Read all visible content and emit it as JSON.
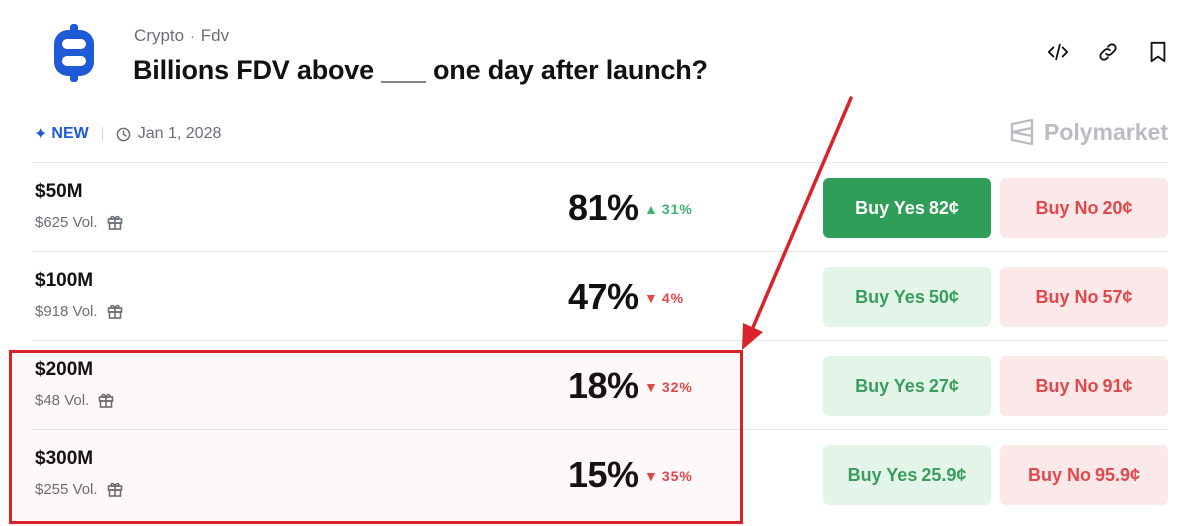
{
  "header": {
    "breadcrumb": [
      "Crypto",
      "Fdv"
    ],
    "breadcrumb_sep": "·",
    "title": "Billions FDV above ___ one day after launch?",
    "logo_icon": "billions-logo-icon",
    "actions": [
      "embed-code-icon",
      "link-icon",
      "bookmark-icon"
    ]
  },
  "meta": {
    "new_label": "NEW",
    "date": "Jan 1, 2028",
    "brand": "Polymarket"
  },
  "colors": {
    "accent_blue": "#1f5bd6",
    "yes_green": "#2f9e58",
    "yes_light": "#e3f5e9",
    "no_red": "#e0484b",
    "no_light": "#fbe8e8",
    "annotation_red": "#d8232a"
  },
  "rows": [
    {
      "label": "$50M",
      "volume": "$625 Vol.",
      "probability": "81%",
      "change": "31%",
      "direction": "up",
      "yes_label": "Buy Yes",
      "yes_price": "82¢",
      "no_label": "Buy No",
      "no_price": "20¢"
    },
    {
      "label": "$100M",
      "volume": "$918 Vol.",
      "probability": "47%",
      "change": "4%",
      "direction": "down",
      "yes_label": "Buy Yes",
      "yes_price": "50¢",
      "no_label": "Buy No",
      "no_price": "57¢"
    },
    {
      "label": "$200M",
      "volume": "$48 Vol.",
      "probability": "18%",
      "change": "32%",
      "direction": "down",
      "yes_label": "Buy Yes",
      "yes_price": "27¢",
      "no_label": "Buy No",
      "no_price": "91¢"
    },
    {
      "label": "$300M",
      "volume": "$255 Vol.",
      "probability": "15%",
      "change": "35%",
      "direction": "down",
      "yes_label": "Buy Yes",
      "yes_price": "25.9¢",
      "no_label": "Buy No",
      "no_price": "95.9¢"
    }
  ]
}
